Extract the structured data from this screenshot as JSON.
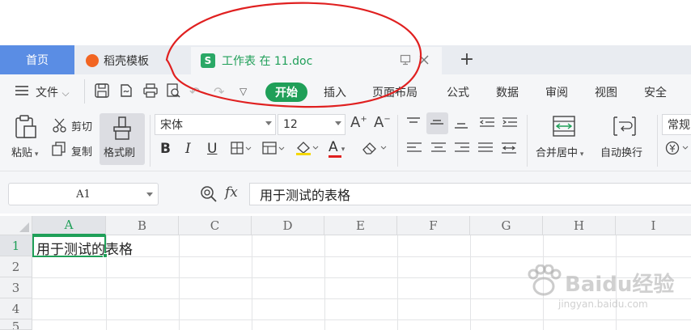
{
  "tabs": {
    "home": "首页",
    "template": "稻壳模板",
    "document": "工作表 在 11.doc",
    "new_tab": "+"
  },
  "toolbar": {
    "file_menu": "文件",
    "menu_items": [
      "开始",
      "插入",
      "页面布局",
      "公式",
      "数据",
      "审阅",
      "视图",
      "安全"
    ]
  },
  "ribbon": {
    "paste": "粘贴",
    "cut": "剪切",
    "copy": "复制",
    "format_painter": "格式刷",
    "font_name": "宋体",
    "font_size": "12",
    "merge_center": "合并居中",
    "wrap_text": "自动换行",
    "number_format": "常规",
    "bold": "B",
    "italic": "I",
    "underline": "U",
    "font_color_letter": "A"
  },
  "formula_bar": {
    "name_box": "A1",
    "fx_label": "fx",
    "content": "用于测试的表格"
  },
  "grid": {
    "columns": [
      "A",
      "B",
      "C",
      "D",
      "E",
      "F",
      "G",
      "H",
      "I"
    ],
    "rows": [
      "1",
      "2",
      "3",
      "4",
      "5"
    ],
    "cell_a1": "用于测试的表格"
  },
  "watermark": {
    "brand": "Baidu经验",
    "url": "jingyan.baidu.com"
  },
  "colors": {
    "accent_green": "#1f9f58",
    "home_tab_blue": "#5a8de4",
    "annotation_red": "#e02020"
  }
}
